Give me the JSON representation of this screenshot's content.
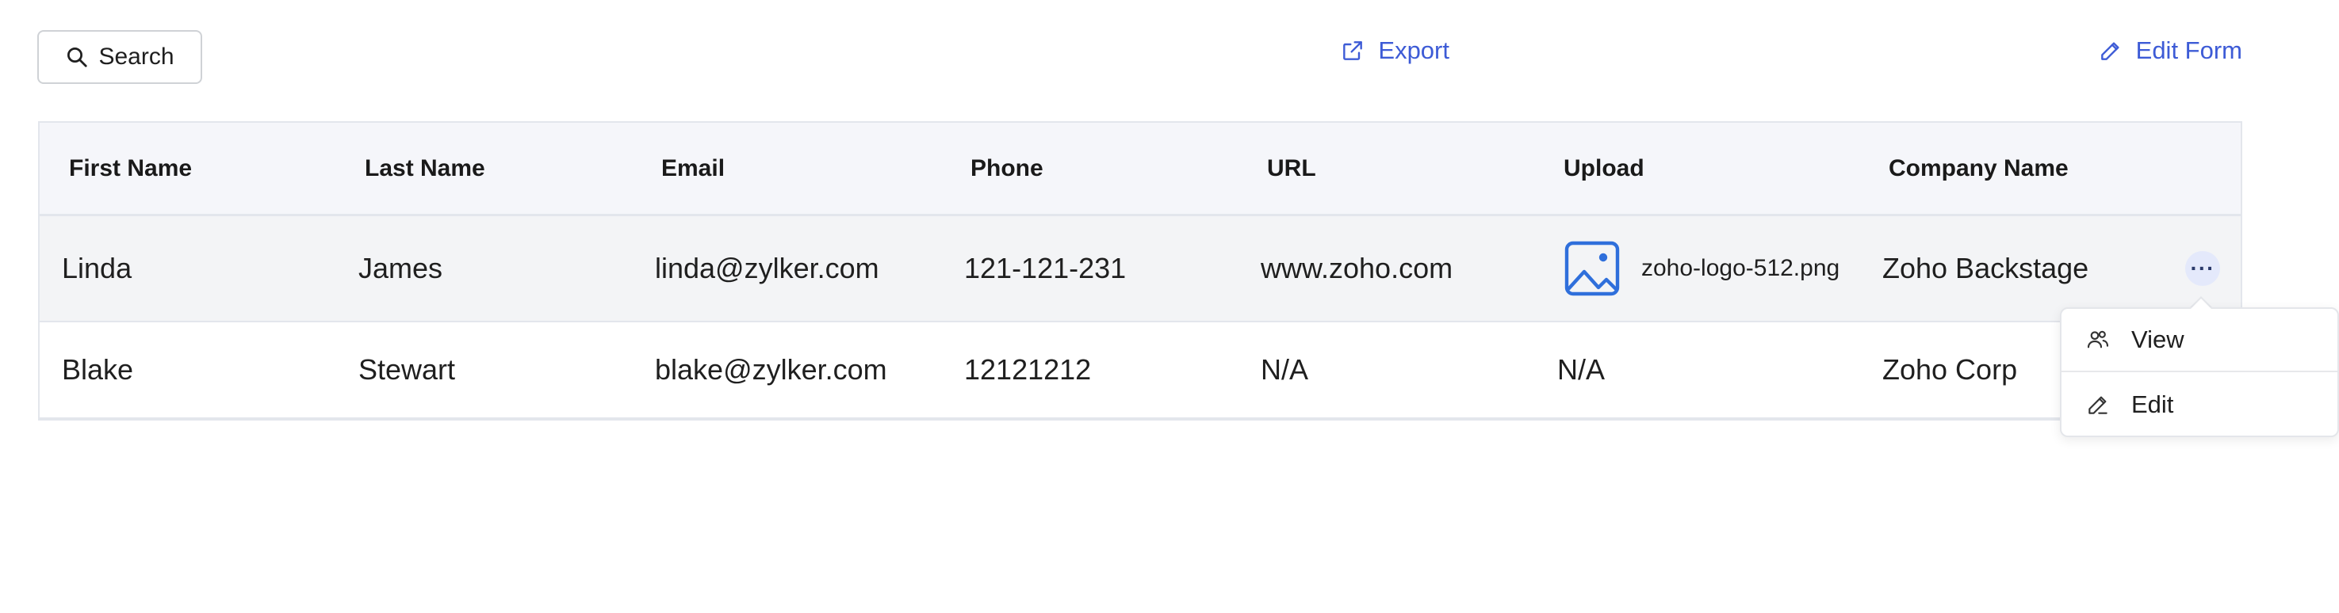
{
  "toolbar": {
    "search_label": "Search",
    "export_label": "Export",
    "edit_form_label": "Edit Form"
  },
  "table": {
    "columns": [
      "First Name",
      "Last Name",
      "Email",
      "Phone",
      "URL",
      "Upload",
      "Company Name"
    ],
    "rows": [
      {
        "first_name": "Linda",
        "last_name": "James",
        "email": "linda@zylker.com",
        "phone": "121-121-231",
        "url": "www.zoho.com",
        "upload": "zoho-logo-512.png",
        "company": "Zoho Backstage"
      },
      {
        "first_name": "Blake",
        "last_name": "Stewart",
        "email": "blake@zylker.com",
        "phone": "12121212",
        "url": "N/A",
        "upload": "N/A",
        "company": "Zoho Corp"
      }
    ]
  },
  "row_menu": {
    "items": [
      {
        "label": "View",
        "icon": "people-icon"
      },
      {
        "label": "Edit",
        "icon": "pencil-icon"
      }
    ]
  },
  "colors": {
    "accent": "#3d5bd6",
    "upload_icon": "#2f6fdb",
    "header_bg": "#f5f6fa"
  }
}
